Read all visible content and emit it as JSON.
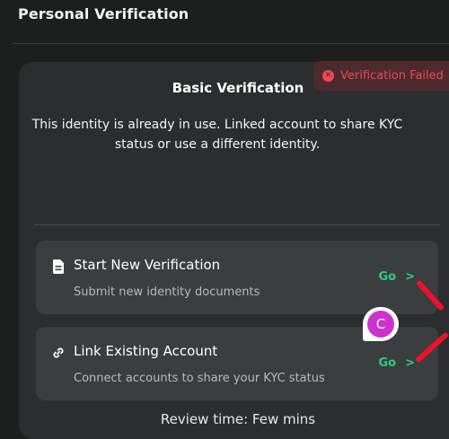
{
  "header": {
    "title": "Personal Verification"
  },
  "badge": {
    "icon": "x-circle-icon",
    "label": "Verification Failed",
    "color": "#ee4857"
  },
  "card": {
    "title": "Basic Verification",
    "message": "This identity is already in use. Linked account to share KYC status or use a different identity."
  },
  "options": [
    {
      "icon": "document-icon",
      "title": "Start New Verification",
      "subtitle": "Submit new identity documents",
      "action": "Go"
    },
    {
      "icon": "link-icon",
      "title": "Link Existing Account",
      "subtitle": "Connect accounts to share your KYC status",
      "action": "Go"
    }
  ],
  "cursor": {
    "initial": "C",
    "color": "#cc33cc"
  },
  "footer": {
    "review_text": "Review time: Few mins"
  },
  "colors": {
    "accent": "#2ecf7a",
    "background": "#1d1f1f",
    "card": "#2b2e2f",
    "option": "#3a3e3f"
  }
}
